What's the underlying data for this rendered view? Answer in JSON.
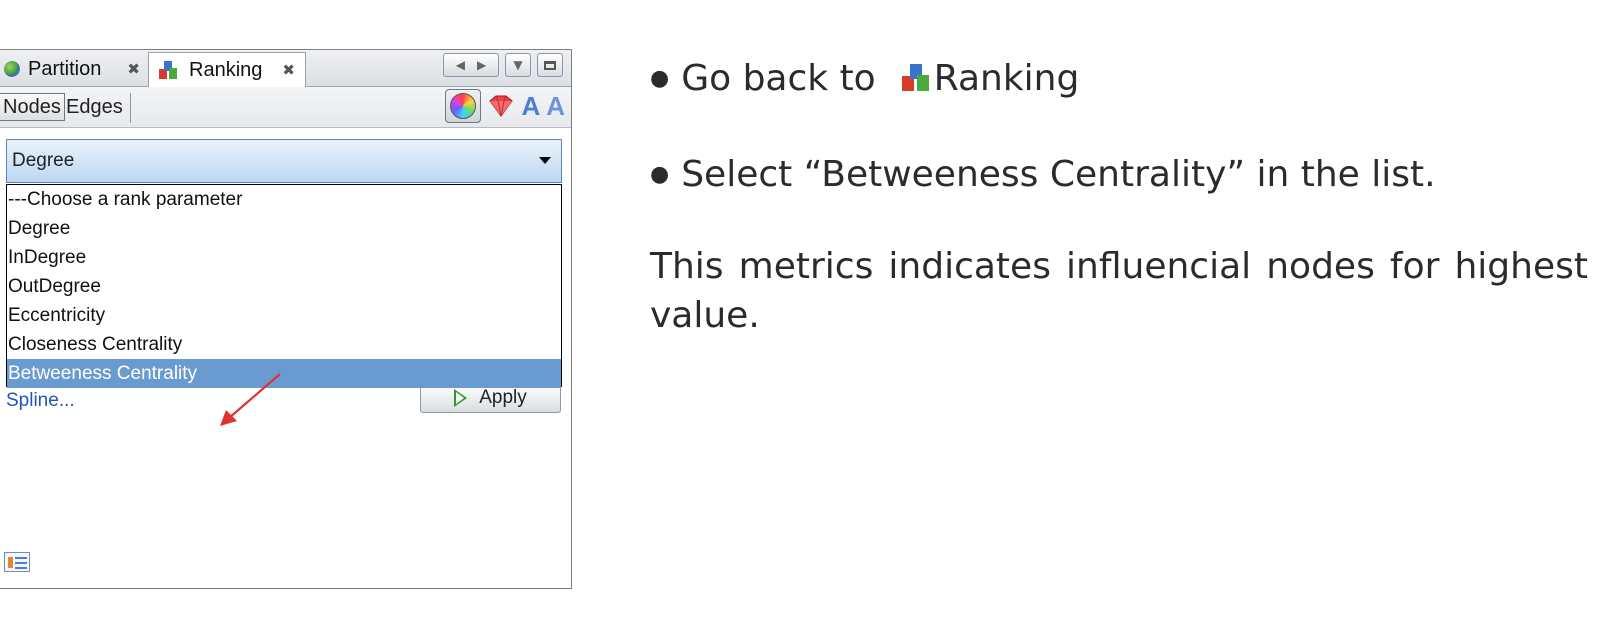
{
  "panel": {
    "tabs": [
      {
        "label": "Partition",
        "close": "✖"
      },
      {
        "label": "Ranking",
        "close": "✖"
      }
    ],
    "toolbar": {
      "nodes_label": "Nodes",
      "edges_label": "Edges",
      "tool_icons": [
        "color-wheel-icon",
        "size-gem-icon",
        "label-color-icon",
        "label-size-icon"
      ]
    },
    "rank_parameter": {
      "selected": "Degree",
      "options": [
        "---Choose a rank parameter",
        "Degree",
        "InDegree",
        "OutDegree",
        "Eccentricity",
        "Closeness Centrality",
        "Betweeness Centrality"
      ],
      "highlighted_option": "Betweeness Centrality"
    },
    "spline_label": "Spline...",
    "apply_label": "Apply",
    "colors": {
      "selection": "#6a9bd0",
      "link": "#1f56b5",
      "annotation_arrow": "#e03030"
    }
  },
  "slide": {
    "bullet1_prefix": "Go back to",
    "bullet1_link": "Ranking",
    "bullet2": "Select “Betweeness Centrality” in the list.",
    "paragraph": "This metrics indicates influencial nodes for highest value."
  }
}
